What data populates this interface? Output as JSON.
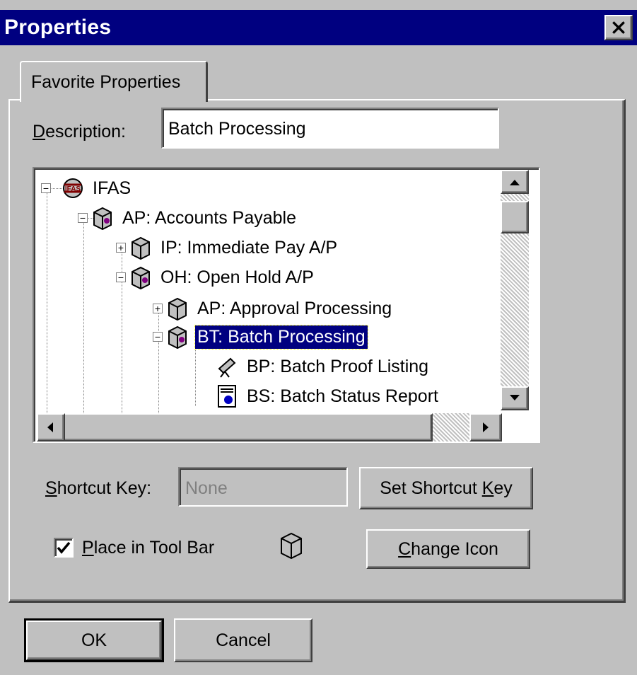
{
  "window": {
    "title": "Properties"
  },
  "tabs": [
    {
      "label": "Favorite Properties"
    }
  ],
  "description": {
    "label_accel": "D",
    "label_rest": "escription:",
    "value": "Batch Processing"
  },
  "tree": {
    "nodes": [
      {
        "label": "IFAS",
        "expander": "−",
        "icon": "ifas-logo-icon"
      },
      {
        "label": "AP: Accounts Payable",
        "expander": "−",
        "icon": "cube-icon"
      },
      {
        "label": "IP: Immediate Pay A/P",
        "expander": "+",
        "icon": "cube-icon"
      },
      {
        "label": "OH: Open Hold A/P",
        "expander": "−",
        "icon": "cube-icon"
      },
      {
        "label": "AP: Approval Processing",
        "expander": "+",
        "icon": "cube-icon"
      },
      {
        "label": "BT: Batch Processing",
        "expander": "−",
        "icon": "cube-icon",
        "selected": true
      },
      {
        "label": "BP: Batch Proof Listing",
        "expander": "",
        "icon": "telescope-icon"
      },
      {
        "label": "BS: Batch Status Report",
        "expander": "",
        "icon": "report-icon"
      }
    ]
  },
  "shortcut": {
    "label_accel": "S",
    "label_rest": "hortcut Key:",
    "value": "None",
    "button_prefix": "Set Shortcut ",
    "button_accel": "K",
    "button_suffix": "ey"
  },
  "toolbar": {
    "checked": true,
    "label_accel": "P",
    "label_rest": "lace in Tool Bar",
    "change_accel": "C",
    "change_rest": "hange Icon"
  },
  "buttons": {
    "ok": "OK",
    "cancel": "Cancel"
  },
  "colors": {
    "titlebar": "#000080",
    "face": "#c0c0c0",
    "selection": "#000080"
  }
}
